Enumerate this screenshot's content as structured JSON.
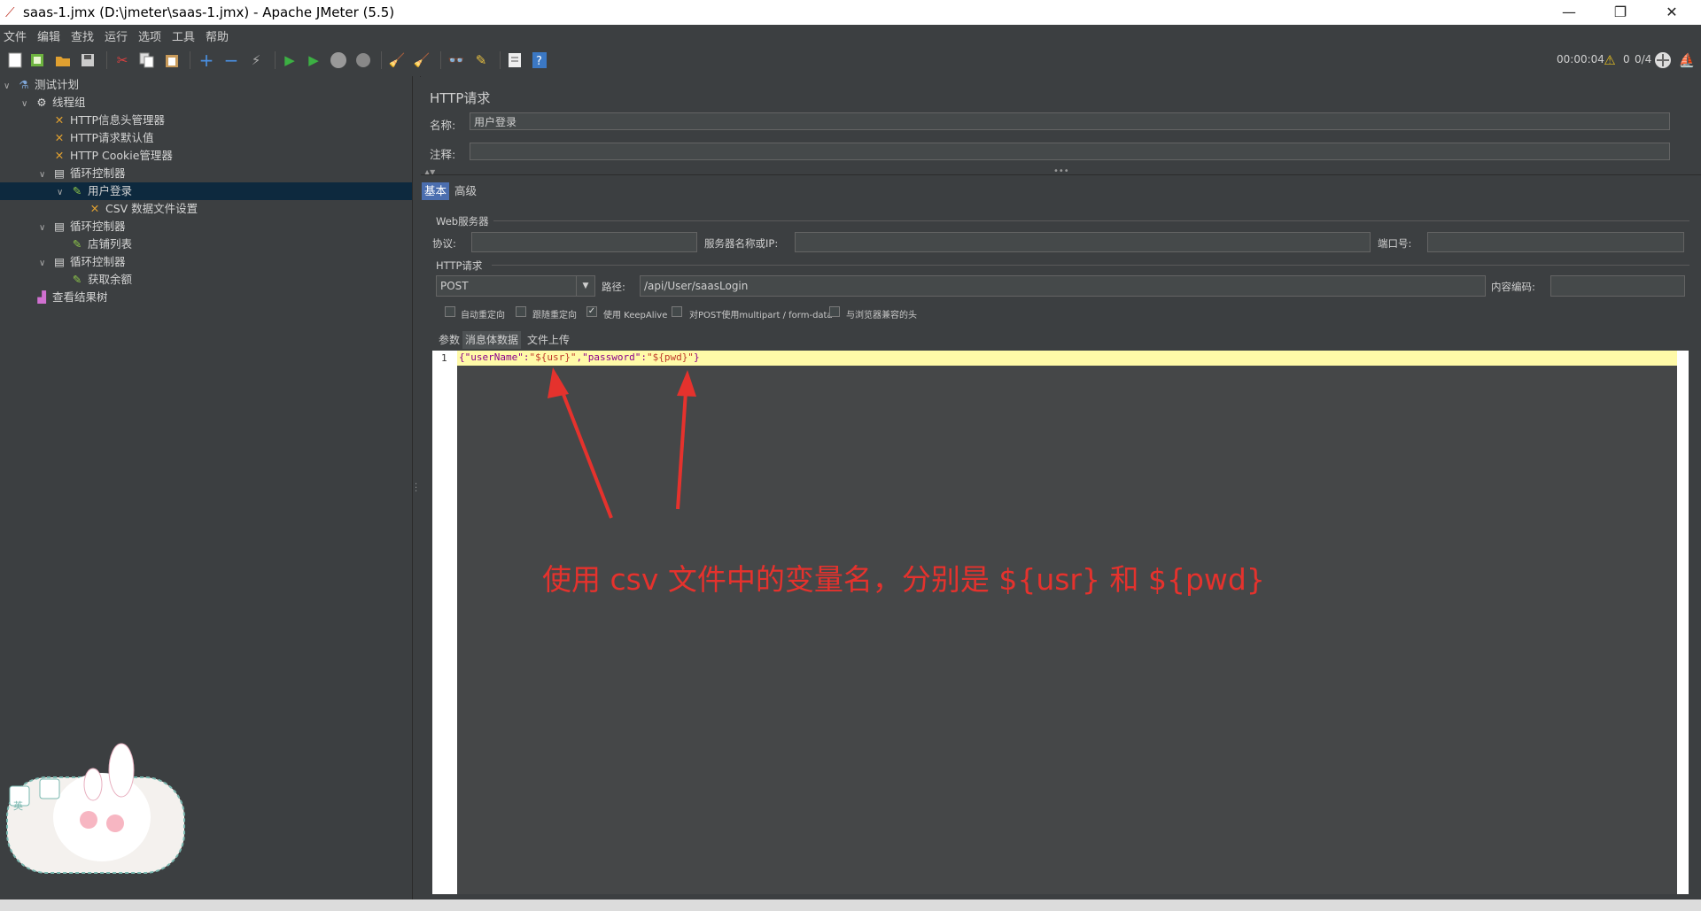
{
  "window": {
    "title": "saas-1.jmx (D:\\jmeter\\saas-1.jmx) - Apache JMeter (5.5)",
    "minimize": "—",
    "restore": "❐",
    "close": "✕"
  },
  "menu": [
    "文件",
    "编辑",
    "查找",
    "运行",
    "选项",
    "工具",
    "帮助"
  ],
  "status": {
    "timer": "00:00:04",
    "warnings": "0",
    "threads": "0/4"
  },
  "tree": [
    {
      "label": "测试计划",
      "icon": "flask-icon"
    },
    {
      "label": "线程组",
      "icon": "gear-icon"
    },
    {
      "label": "HTTP信息头管理器",
      "icon": "wrench-icon"
    },
    {
      "label": "HTTP请求默认值",
      "icon": "wrench-icon"
    },
    {
      "label": "HTTP Cookie管理器",
      "icon": "wrench-icon"
    },
    {
      "label": "循环控制器",
      "icon": "loop-icon"
    },
    {
      "label": "用户登录",
      "icon": "pipette-icon"
    },
    {
      "label": "CSV 数据文件设置",
      "icon": "wrench-icon"
    },
    {
      "label": "循环控制器",
      "icon": "loop-icon"
    },
    {
      "label": "店铺列表",
      "icon": "pipette-icon"
    },
    {
      "label": "循环控制器",
      "icon": "loop-icon"
    },
    {
      "label": "获取余额",
      "icon": "pipette-icon"
    },
    {
      "label": "查看结果树",
      "icon": "chart-icon"
    }
  ],
  "panel": {
    "title": "HTTP请求",
    "name_label": "名称:",
    "name_value": "用户登录",
    "comment_label": "注释:",
    "comment_value": "",
    "tabs": [
      "基本",
      "高级"
    ],
    "web_server_group": "Web服务器",
    "protocol_label": "协议:",
    "protocol_value": "",
    "server_label": "服务器名称或IP:",
    "server_value": "",
    "port_label": "端口号:",
    "port_value": "",
    "http_group": "HTTP请求",
    "method": "POST",
    "path_label": "路径:",
    "path_value": "/api/User/saasLogin",
    "encoding_label": "内容编码:",
    "encoding_value": "",
    "options": [
      {
        "label": "自动重定向",
        "checked": false
      },
      {
        "label": "跟随重定向",
        "checked": false
      },
      {
        "label": "使用 KeepAlive",
        "checked": true
      },
      {
        "label": "对POST使用multipart / form-data",
        "checked": false
      },
      {
        "label": "与浏览器兼容的头",
        "checked": false
      }
    ],
    "body_tabs": [
      "参数",
      "消息体数据",
      "文件上传"
    ],
    "line_number": "1",
    "body_code_parts": [
      "{\"userName\":",
      "\"${usr}\"",
      ",\"password\":",
      "\"${pwd}\"",
      "}"
    ]
  },
  "annotation": "使用 csv 文件中的变量名，分别是 ${usr} 和 ${pwd}"
}
